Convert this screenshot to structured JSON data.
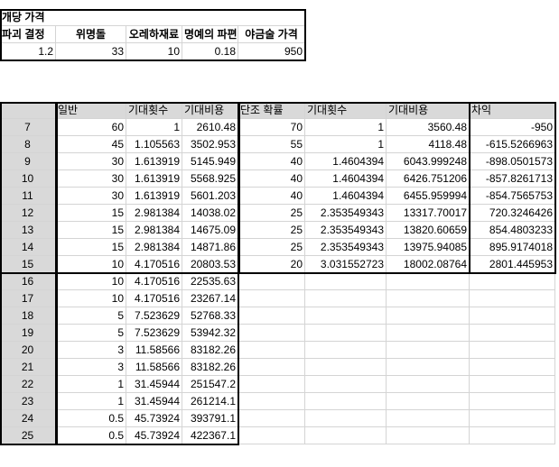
{
  "top_table": {
    "title": "개당 가격",
    "headers": [
      "파괴 결정",
      "위명돌",
      "오레하재료",
      "명예의 파편",
      "야금술 가격"
    ],
    "values": [
      "1.2",
      "33",
      "10",
      "0.18",
      "950"
    ]
  },
  "main_table": {
    "headers": [
      "",
      "일반",
      "기대횟수",
      "기대비용",
      "단조 확률",
      "기대횟수",
      "기대비용",
      "차익"
    ],
    "rows": [
      [
        "7",
        "60",
        "1",
        "2610.48",
        "70",
        "1",
        "3560.48",
        "-950"
      ],
      [
        "8",
        "45",
        "1.105563",
        "3502.953",
        "55",
        "1",
        "4118.48",
        "-615.5266963"
      ],
      [
        "9",
        "30",
        "1.613919",
        "5145.949",
        "40",
        "1.4604394",
        "6043.999248",
        "-898.0501573"
      ],
      [
        "10",
        "30",
        "1.613919",
        "5568.925",
        "40",
        "1.4604394",
        "6426.751206",
        "-857.8261713"
      ],
      [
        "11",
        "30",
        "1.613919",
        "5601.203",
        "40",
        "1.4604394",
        "6455.959994",
        "-854.7565753"
      ],
      [
        "12",
        "15",
        "2.981384",
        "14038.02",
        "25",
        "2.353549343",
        "13317.70017",
        "720.3246426"
      ],
      [
        "13",
        "15",
        "2.981384",
        "14675.09",
        "25",
        "2.353549343",
        "13820.60659",
        "854.4803233"
      ],
      [
        "14",
        "15",
        "2.981384",
        "14871.86",
        "25",
        "2.353549343",
        "13975.94085",
        "895.9174018"
      ],
      [
        "15",
        "10",
        "4.170516",
        "20803.53",
        "20",
        "3.031552723",
        "18002.08764",
        "2801.445953"
      ],
      [
        "16",
        "10",
        "4.170516",
        "22535.63",
        "",
        "",
        "",
        ""
      ],
      [
        "17",
        "10",
        "4.170516",
        "23267.14",
        "",
        "",
        "",
        ""
      ],
      [
        "18",
        "5",
        "7.523629",
        "52768.33",
        "",
        "",
        "",
        ""
      ],
      [
        "19",
        "5",
        "7.523629",
        "53942.32",
        "",
        "",
        "",
        ""
      ],
      [
        "20",
        "3",
        "11.58566",
        "83182.26",
        "",
        "",
        "",
        ""
      ],
      [
        "21",
        "3",
        "11.58566",
        "83182.26",
        "",
        "",
        "",
        ""
      ],
      [
        "22",
        "1",
        "31.45944",
        "251547.2",
        "",
        "",
        "",
        ""
      ],
      [
        "23",
        "1",
        "31.45944",
        "261214.1",
        "",
        "",
        "",
        ""
      ],
      [
        "24",
        "0.5",
        "45.73924",
        "393791.1",
        "",
        "",
        "",
        ""
      ],
      [
        "25",
        "0.5",
        "45.73924",
        "422367.1",
        "",
        "",
        "",
        ""
      ]
    ]
  },
  "colors": {
    "header_fill": "#d9d9d9",
    "gridline": "#d4d4d4",
    "border": "#000000"
  }
}
